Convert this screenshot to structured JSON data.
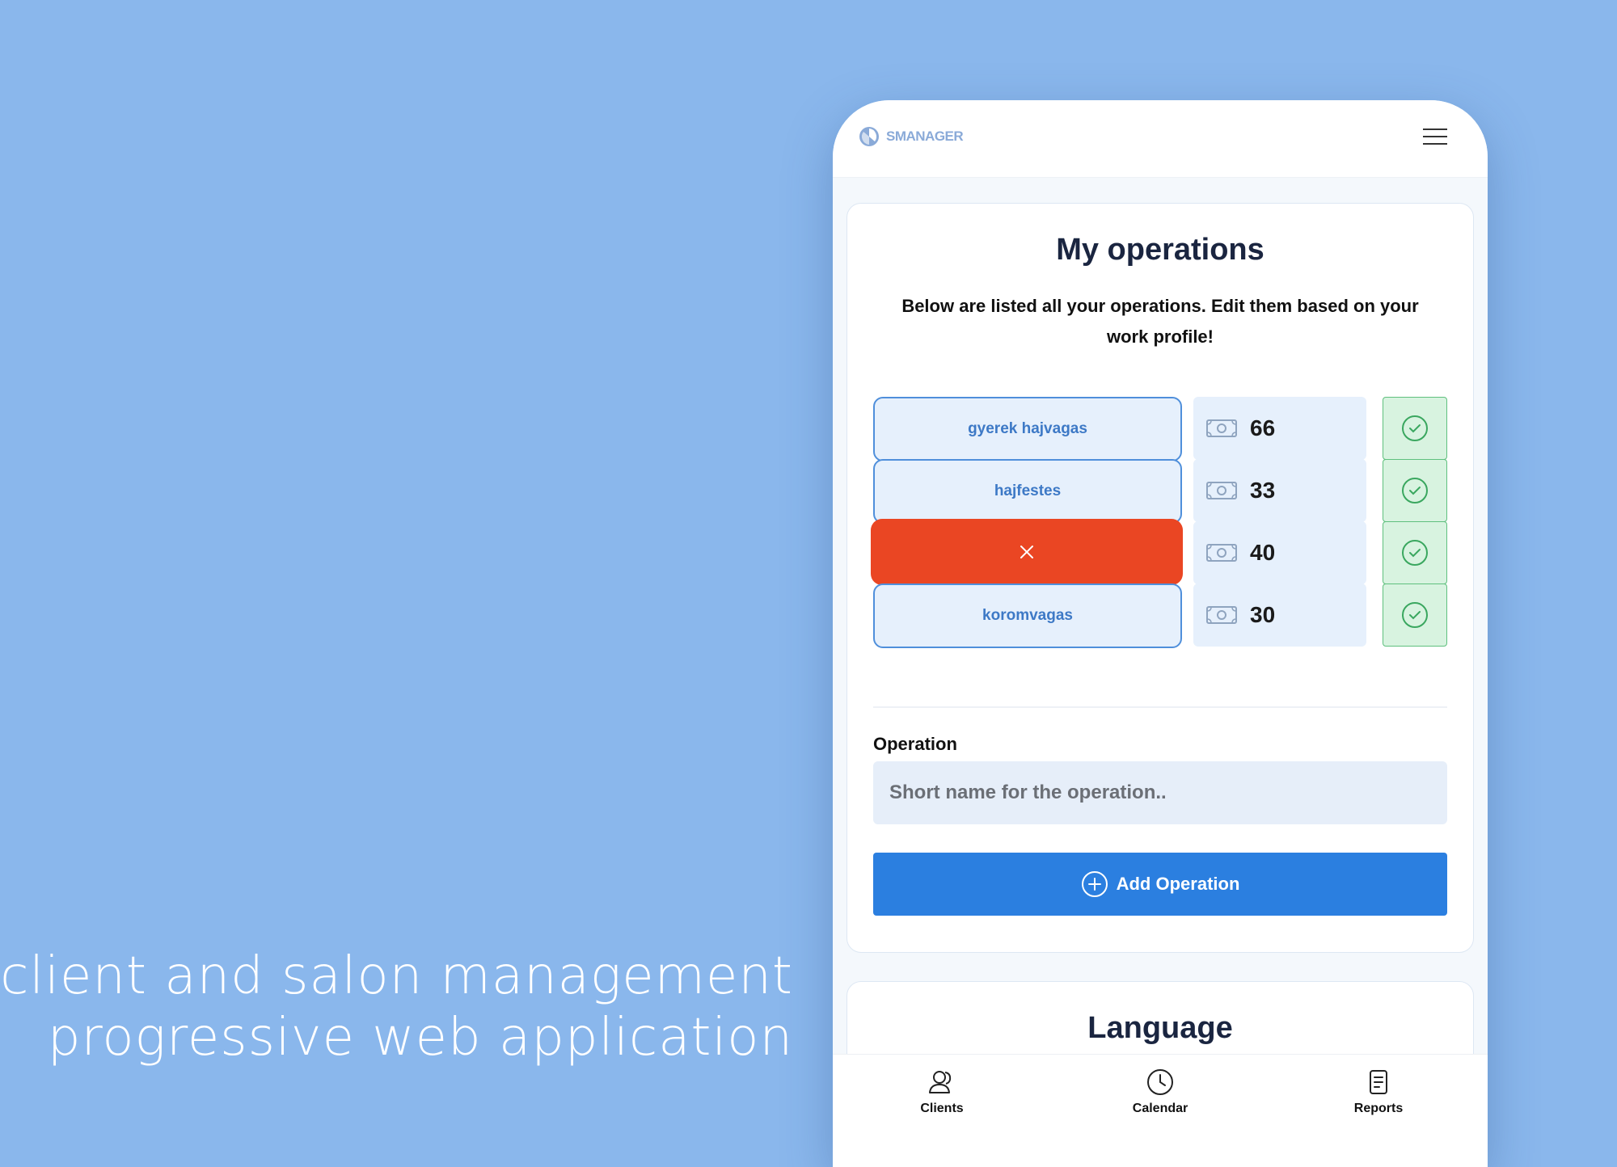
{
  "tagline": {
    "line1": "client and salon management",
    "line2": "progressive web application"
  },
  "app": {
    "logo_text": "SMANAGER"
  },
  "operations_card": {
    "title": "My operations",
    "subtitle": "Below are listed all your operations. Edit them based on your work profile!",
    "operations": [
      {
        "name": "gyerek hajvagas",
        "price": "66",
        "state": "normal"
      },
      {
        "name": "hajfestes",
        "price": "33",
        "state": "normal"
      },
      {
        "name": "",
        "price": "40",
        "state": "deleting"
      },
      {
        "name": "koromvagas",
        "price": "30",
        "state": "normal"
      }
    ],
    "field_label": "Operation",
    "field_placeholder": "Short name for the operation..",
    "add_button_label": "Add Operation"
  },
  "language_card": {
    "title": "Language"
  },
  "bottom_nav": {
    "items": [
      {
        "label": "Clients",
        "icon": "clients-icon"
      },
      {
        "label": "Calendar",
        "icon": "clock-icon"
      },
      {
        "label": "Reports",
        "icon": "reports-icon"
      }
    ]
  },
  "colors": {
    "background": "#8ab7ec",
    "accent": "#2b7fe0",
    "delete": "#ea4623",
    "success": "#5fc07e"
  }
}
